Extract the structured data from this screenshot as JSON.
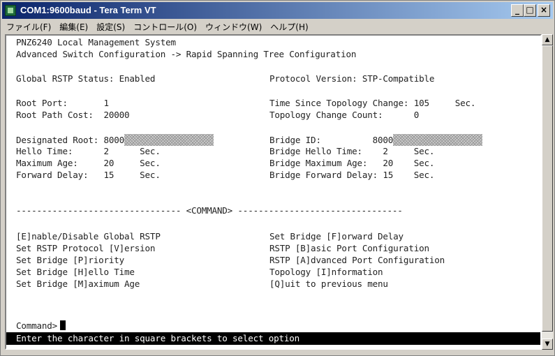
{
  "window": {
    "title": "COM1:9600baud - Tera Term VT",
    "minimize": "_",
    "maximize": "□",
    "close": "×"
  },
  "menu": [
    "ファイル(F)",
    "編集(E)",
    "設定(S)",
    "コントロール(O)",
    "ウィンドウ(W)",
    "ヘルプ(H)"
  ],
  "terminal": {
    "header1": "PNZ6240 Local Management System",
    "header2": "Advanced Switch Configuration -> Rapid Spanning Tree Configuration",
    "global_status": "Global RSTP Status: Enabled",
    "protocol_version": "Protocol Version: STP-Compatible",
    "root_port": "Root Port:       1",
    "time_since_change": "Time Since Topology Change: 105     Sec.",
    "root_path_cost": "Root Path Cost:  20000",
    "topology_change_count": "Topology Change Count:      0",
    "designated_root_label": "Designated Root: 8000",
    "bridge_id_label": "Bridge ID:          8000",
    "hello_time": "Hello Time:      2      Sec.",
    "bridge_hello_time": "Bridge Hello Time:    2     Sec.",
    "maximum_age": "Maximum Age:     20     Sec.",
    "bridge_maximum_age": "Bridge Maximum Age:   20    Sec.",
    "forward_delay": "Forward Delay:   15     Sec.",
    "bridge_forward_delay": "Bridge Forward Delay: 15    Sec.",
    "separator": "-------------------------------- <COMMAND> --------------------------------",
    "commands_left": [
      "[E]nable/Disable Global RSTP",
      "Set RSTP Protocol [V]ersion",
      "Set Bridge [P]riority",
      "Set Bridge [H]ello Time",
      "Set Bridge [M]aximum Age"
    ],
    "commands_right": [
      "Set Bridge [F]orward Delay",
      "RSTP [B]asic Port Configuration",
      "RSTP [A]dvanced Port Configuration",
      "Topology [I]nformation",
      "[Q]uit to previous menu"
    ],
    "prompt": "Command>",
    "status_line": "Enter the character in square brackets to select option"
  },
  "scrollbar": {
    "up": "▲",
    "down": "▼"
  }
}
